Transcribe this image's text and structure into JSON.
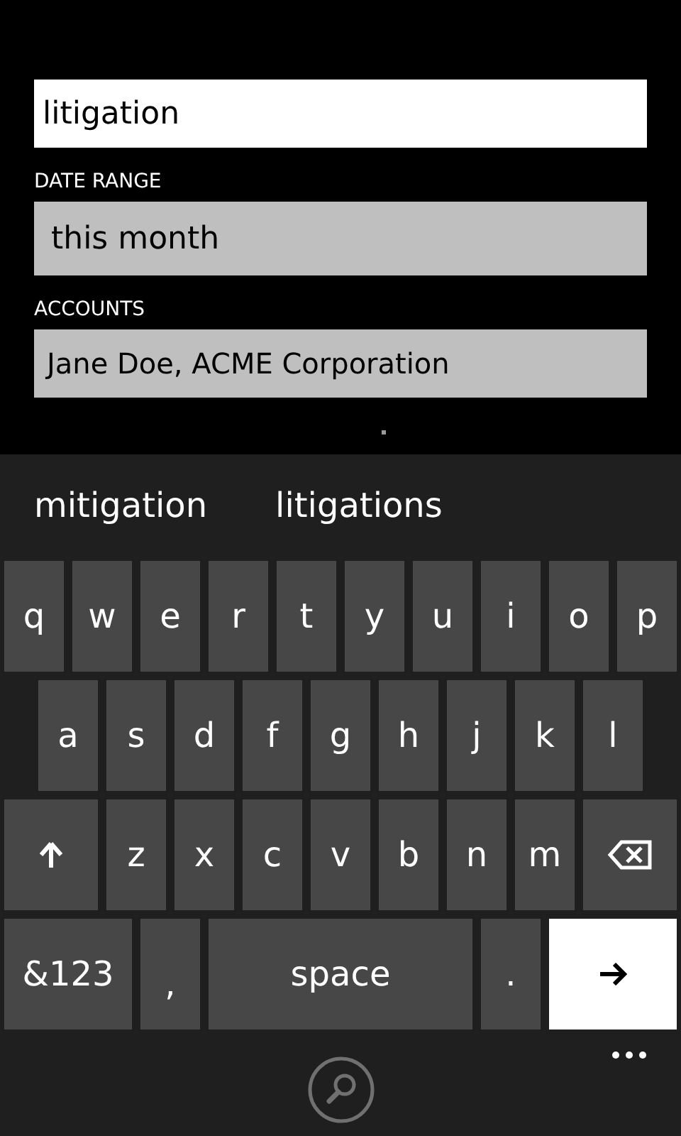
{
  "search_field": {
    "value": "litigation"
  },
  "fields": [
    {
      "label": "DATE RANGE",
      "value": "this month"
    },
    {
      "label": "ACCOUNTS",
      "value": "Jane Doe, ACME Corporation"
    }
  ],
  "suggestions": [
    "mitigation",
    "litigations"
  ],
  "keyboard": {
    "rows": [
      {
        "keys": [
          {
            "kind": "letter",
            "label": "q"
          },
          {
            "kind": "letter",
            "label": "w"
          },
          {
            "kind": "letter",
            "label": "e"
          },
          {
            "kind": "letter",
            "label": "r"
          },
          {
            "kind": "letter",
            "label": "t"
          },
          {
            "kind": "letter",
            "label": "y"
          },
          {
            "kind": "letter",
            "label": "u"
          },
          {
            "kind": "letter",
            "label": "i"
          },
          {
            "kind": "letter",
            "label": "o"
          },
          {
            "kind": "letter",
            "label": "p"
          }
        ]
      },
      {
        "keys": [
          {
            "kind": "letter",
            "label": "a"
          },
          {
            "kind": "letter",
            "label": "s"
          },
          {
            "kind": "letter",
            "label": "d"
          },
          {
            "kind": "letter",
            "label": "f"
          },
          {
            "kind": "letter",
            "label": "g"
          },
          {
            "kind": "letter",
            "label": "h"
          },
          {
            "kind": "letter",
            "label": "j"
          },
          {
            "kind": "letter",
            "label": "k"
          },
          {
            "kind": "letter",
            "label": "l"
          }
        ]
      },
      {
        "keys": [
          {
            "kind": "shift"
          },
          {
            "kind": "letter",
            "label": "z"
          },
          {
            "kind": "letter",
            "label": "x"
          },
          {
            "kind": "letter",
            "label": "c"
          },
          {
            "kind": "letter",
            "label": "v"
          },
          {
            "kind": "letter",
            "label": "b"
          },
          {
            "kind": "letter",
            "label": "n"
          },
          {
            "kind": "letter",
            "label": "m"
          },
          {
            "kind": "backspace"
          }
        ]
      },
      {
        "keys": [
          {
            "kind": "symbols",
            "label": "&123"
          },
          {
            "kind": "comma",
            "label": ","
          },
          {
            "kind": "space",
            "label": "space"
          },
          {
            "kind": "period",
            "label": "."
          },
          {
            "kind": "enter"
          }
        ]
      }
    ]
  }
}
